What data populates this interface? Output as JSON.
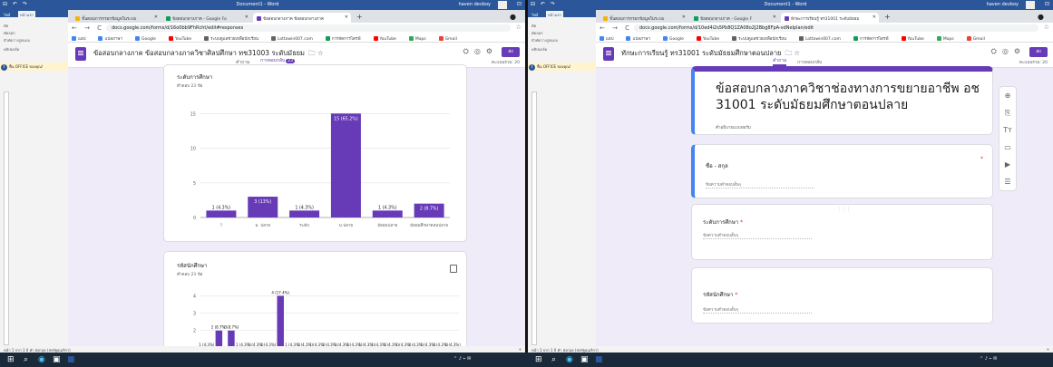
{
  "word": {
    "doc_title": "Document1 - Word",
    "user": "haven devboy",
    "tabs": [
      "ไฟล์",
      "หน้าแรก"
    ],
    "clipboard": [
      "ตัด",
      "คัดลอก",
      "ตัวคัดวางรูปแบบ",
      "คลิปบอร์ด"
    ],
    "info_bar": "ฟื้น OFFICE ของคุณ!",
    "status_left": "หน้า 1 จาก 1   0 คำ",
    "status_lang": "อังกฤษ (สหรัฐอเมริกา)",
    "status_zoom": "+"
  },
  "left": {
    "tabs": [
      {
        "label": "ขั้นตอนการกรอกข้อมูลในระบบ",
        "color": "#f6b40a",
        "active": false
      },
      {
        "label": "ข้อสอบกลางภาค - Google Fo",
        "color": "#0f9d58",
        "active": false
      },
      {
        "label": "ข้อสอบกลางภาค ข้อสอบกลางภาค",
        "color": "#673ab7",
        "active": true
      }
    ],
    "url": "docs.google.com/forms/d/16o0bb9FhRcht/edit#responses",
    "bookmarks": [
      {
        "label": "แอป",
        "color": "#4285f4"
      },
      {
        "label": "แปลภาษา",
        "color": "#4285f4"
      },
      {
        "label": "Google",
        "color": "#4285f4"
      },
      {
        "label": "YouTube",
        "color": "#ff0000"
      },
      {
        "label": "ระบบดูแลช่วยเหลือนักเรียน",
        "color": "#5f6368"
      },
      {
        "label": "Lottowin007.com",
        "color": "#5f6368"
      },
      {
        "label": "การจัดการไดรฟ์",
        "color": "#0f9d58"
      },
      {
        "label": "YouTube",
        "color": "#ff0000"
      },
      {
        "label": "Maps",
        "color": "#34a853"
      },
      {
        "label": "Gmail",
        "color": "#ea4335"
      }
    ],
    "form_title": "ข้อสอบกลางภาค  ข้อสอบกลางภาควิชาศิลปศึกษา  ทช31003  ระดับมัธยม",
    "tab_questions": "คำถาม",
    "tab_responses": "การตอบกลับ",
    "responses_count": "23",
    "total_points": "คะแนนรวม: 20",
    "send_label": "ส่ง",
    "card1_title": "ระดับการศึกษา",
    "card1_sub": "คำตอบ 23 ข้อ",
    "card2_title": "รหัสนักศึกษา",
    "card2_sub": "คำตอบ 23 ข้อ"
  },
  "chart_data": [
    {
      "type": "bar",
      "title": "ระดับการศึกษา",
      "categories": [
        "?",
        "ม. ปลาย",
        "ระดับ",
        "ม.ปลาย",
        "มัธยมปลาย",
        "มัธยมศึกษาตอนปลาย"
      ],
      "values": [
        1,
        3,
        1,
        15,
        1,
        2
      ],
      "data_labels": [
        "1 (4.3%)",
        "3 (13%)",
        "1 (4.3%)",
        "15 (65.2%)",
        "1 (4.3%)",
        "2 (8.7%)"
      ],
      "yticks": [
        0,
        5,
        10,
        15
      ],
      "ylim": [
        0,
        17
      ],
      "color": "#673ab7"
    },
    {
      "type": "bar",
      "title": "รหัสนักศึกษา",
      "values": [
        1,
        2,
        2,
        1,
        1,
        1,
        4,
        1,
        1,
        1,
        1,
        1,
        1,
        1,
        1,
        1,
        1,
        1,
        1,
        1,
        1
      ],
      "data_labels": [
        "1 (4.3%)",
        "2 (8.7%)",
        "2 (8.7%)",
        "1 (4.3%)",
        "1 (4.3%)",
        "1 (4.3%)",
        "4 (17.4%)",
        "1 (4.3%)",
        "1 (4.3%)",
        "1 (4.3%)",
        "1 (4.3%)",
        "1 (4.3%)",
        "1 (4.3%)",
        "1 (4.3%)",
        "1 (4.3%)",
        "1 (4.3%)",
        "1 (4.3%)",
        "1 (4.3%)",
        "1 (4.3%)",
        "1 (4.3%)",
        "1 (4.3%)"
      ],
      "yticks": [
        1,
        2,
        3,
        4
      ],
      "ylim": [
        0,
        4.6
      ],
      "color": "#673ab7"
    }
  ],
  "right": {
    "tabs": [
      {
        "label": "ขั้นตอนการกรอกข้อมูลในระบบ",
        "color": "#f6b40a",
        "active": false
      },
      {
        "label": "ข้อสอบกลางภาค - Google F",
        "color": "#0f9d58",
        "active": false
      },
      {
        "label": "ทักษะการเรียนรู้ ทร31001 ระดับมัธยม",
        "color": "#673ab7",
        "active": true
      }
    ],
    "url": "docs.google.com/forms/d/10ed4i2s5Pb8Q1ZA08o2J2Bbg8FpA-vdNelplan/edit",
    "form_title": "ทักษะการเรียนรู้ ทร31001 ระดับมัธยมศึกษาตอนปลาย",
    "tab_questions": "คำถาม",
    "tab_responses": "การตอบกลับ",
    "total_points": "คะแนนรวม: 20",
    "send_label": "ส่ง",
    "quiz_title": "ข้อสอบกลางภาควิชาช่องทางการขยายอาชีพ อช 31001 ระดับมัธยมศึกษาตอนปลาย",
    "quiz_desc": "คำอธิบายแบบฟอร์ม",
    "questions": [
      {
        "label": "ชื่อ - สกุล",
        "answer": "ข้อความคำตอบสั้นๆ"
      },
      {
        "label": "ระดับการศึกษา",
        "answer": "ข้อความคำตอบสั้นๆ"
      },
      {
        "label": "รหัสนักศึกษา",
        "answer": "ข้อความคำตอบสั้นๆ"
      }
    ],
    "side_tools": [
      "add-question-icon",
      "import-icon",
      "title-icon",
      "image-icon",
      "video-icon",
      "section-icon"
    ]
  }
}
